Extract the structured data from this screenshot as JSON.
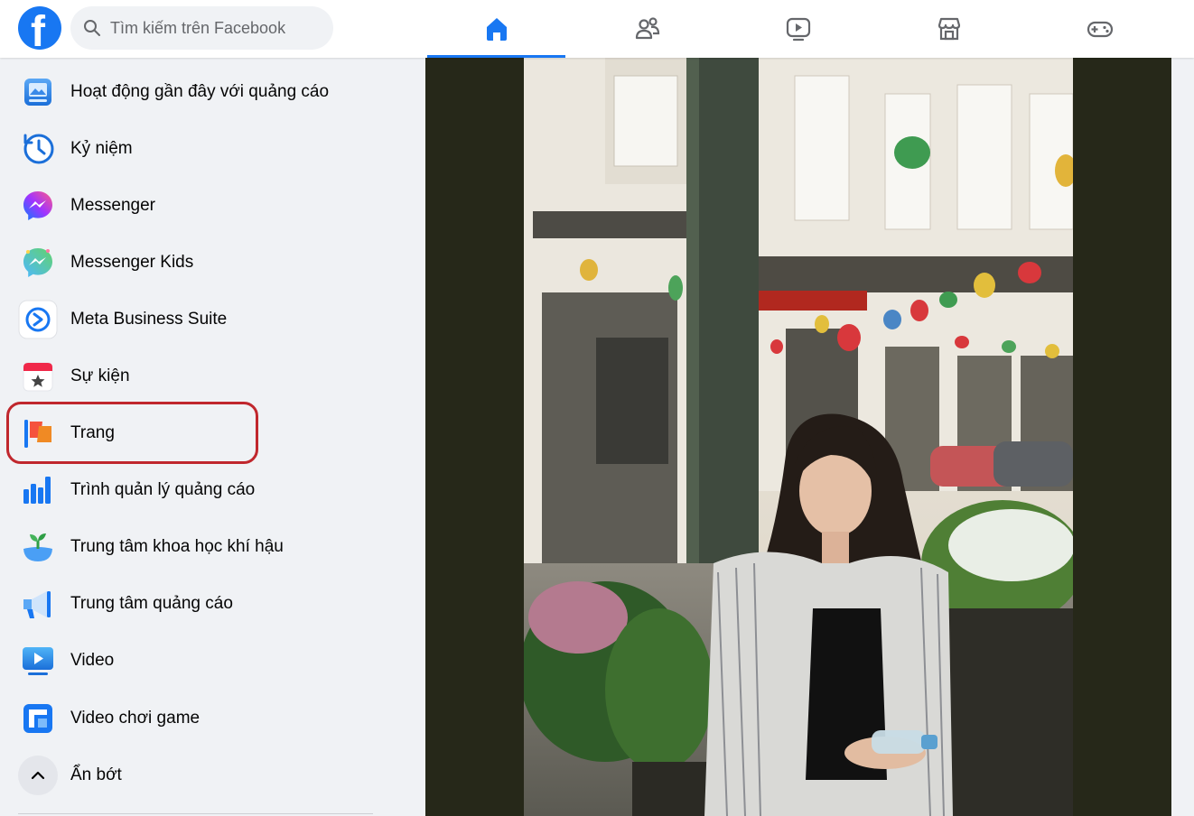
{
  "header": {
    "logo_letter": "f",
    "search_placeholder": "Tìm kiếm trên Facebook",
    "tabs": [
      {
        "name": "home",
        "icon": "home-icon",
        "active": true
      },
      {
        "name": "friends",
        "icon": "friends-icon",
        "active": false
      },
      {
        "name": "watch",
        "icon": "video-play-icon",
        "active": false
      },
      {
        "name": "marketplace",
        "icon": "marketplace-icon",
        "active": false
      },
      {
        "name": "gaming",
        "icon": "gamepad-icon",
        "active": false
      }
    ]
  },
  "sidebar": {
    "items": [
      {
        "label": "Hoạt động gần đây với quảng cáo",
        "icon": "ad-activity-icon"
      },
      {
        "label": "Kỷ niệm",
        "icon": "memories-clock-icon"
      },
      {
        "label": "Messenger",
        "icon": "messenger-icon"
      },
      {
        "label": "Messenger Kids",
        "icon": "messenger-kids-icon"
      },
      {
        "label": "Meta Business Suite",
        "icon": "meta-business-suite-icon"
      },
      {
        "label": "Sự kiện",
        "icon": "events-calendar-icon"
      },
      {
        "label": "Trang",
        "icon": "pages-flag-icon"
      },
      {
        "label": "Trình quản lý quảng cáo",
        "icon": "ads-manager-icon"
      },
      {
        "label": "Trung tâm khoa học khí hậu",
        "icon": "climate-science-icon"
      },
      {
        "label": "Trung tâm quảng cáo",
        "icon": "ad-center-megaphone-icon"
      },
      {
        "label": "Video",
        "icon": "video-icon"
      },
      {
        "label": "Video chơi game",
        "icon": "gaming-video-icon"
      },
      {
        "label": "Ẩn bớt",
        "icon": "chevron-up-icon"
      }
    ],
    "highlighted_item": "Trang"
  },
  "colors": {
    "brand": "#1877f2",
    "highlight_border": "#c0272d",
    "background": "#f0f2f5"
  }
}
